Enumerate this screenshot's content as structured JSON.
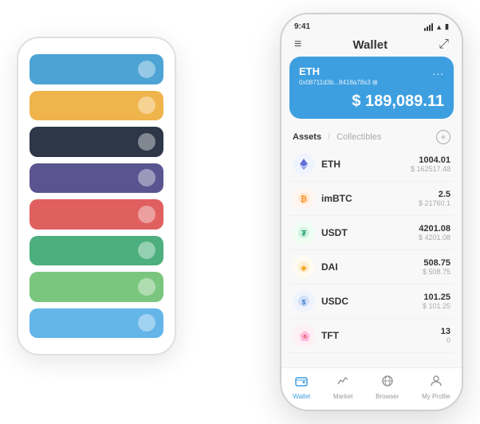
{
  "scene": {
    "left_phone": {
      "strips": [
        {
          "color": "strip-blue",
          "label": "Blue card"
        },
        {
          "color": "strip-yellow",
          "label": "Yellow card"
        },
        {
          "color": "strip-dark",
          "label": "Dark card"
        },
        {
          "color": "strip-purple",
          "label": "Purple card"
        },
        {
          "color": "strip-red",
          "label": "Red card"
        },
        {
          "color": "strip-green",
          "label": "Green card"
        },
        {
          "color": "strip-lightgreen",
          "label": "Light green card"
        },
        {
          "color": "strip-lightblue",
          "label": "Light blue card"
        }
      ]
    },
    "right_phone": {
      "status_bar": {
        "time": "9:41",
        "battery": "🔋"
      },
      "nav": {
        "menu_icon": "≡",
        "title": "Wallet",
        "expand_icon": "⤢"
      },
      "eth_card": {
        "label": "ETH",
        "more": "...",
        "address": "0x08711d3b...8418a78s3  ⊞",
        "balance": "$ 189,089.11"
      },
      "assets_section": {
        "tab_active": "Assets",
        "divider": "/",
        "tab_inactive": "Collectibles",
        "add_icon": "+"
      },
      "assets": [
        {
          "name": "ETH",
          "icon": "♦",
          "icon_class": "icon-eth",
          "amount": "1004.01",
          "usd": "$ 162517.48"
        },
        {
          "name": "imBTC",
          "icon": "◎",
          "icon_class": "icon-imbtc",
          "amount": "2.5",
          "usd": "$ 21760.1"
        },
        {
          "name": "USDT",
          "icon": "₮",
          "icon_class": "icon-usdt",
          "amount": "4201.08",
          "usd": "$ 4201.08"
        },
        {
          "name": "DAI",
          "icon": "◈",
          "icon_class": "icon-dai",
          "amount": "508.75",
          "usd": "$ 508.75"
        },
        {
          "name": "USDC",
          "icon": "⊙",
          "icon_class": "icon-usdc",
          "amount": "101.25",
          "usd": "$ 101.25"
        },
        {
          "name": "TFT",
          "icon": "🌸",
          "icon_class": "icon-tft",
          "amount": "13",
          "usd": "0"
        }
      ],
      "bottom_nav": [
        {
          "label": "Wallet",
          "icon": "⊙",
          "active": true
        },
        {
          "label": "Market",
          "icon": "📊",
          "active": false
        },
        {
          "label": "Browser",
          "icon": "👤",
          "active": false
        },
        {
          "label": "My Profile",
          "icon": "👤",
          "active": false
        }
      ]
    }
  }
}
